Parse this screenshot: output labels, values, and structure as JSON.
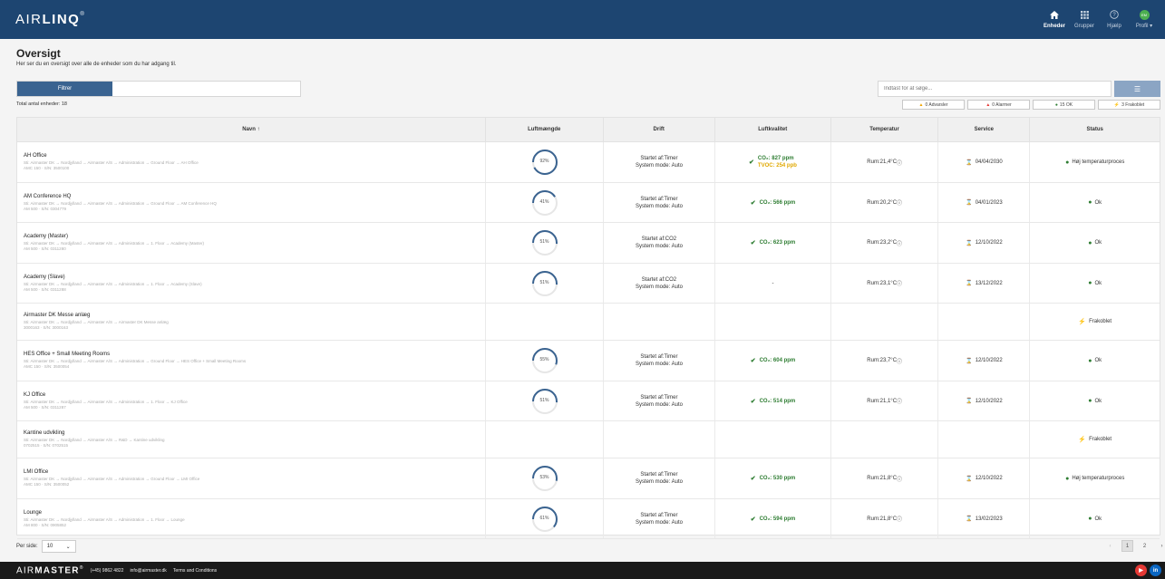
{
  "app": {
    "logo_light": "AIR",
    "logo_bold": "LINQ",
    "logo_mark": "®"
  },
  "nav": [
    {
      "label": "Enheder",
      "icon": "home-icon",
      "active": true
    },
    {
      "label": "Grupper",
      "icon": "grid-icon",
      "active": false
    },
    {
      "label": "Hjælp",
      "icon": "help-icon",
      "active": false
    },
    {
      "label": "Profil ▾",
      "icon": "profile-icon",
      "active": false,
      "badge": "EM"
    }
  ],
  "page": {
    "title": "Oversigt",
    "subtitle": "Her ser du en oversigt over alle de enheder som du har adgang til."
  },
  "filter": {
    "label": "Filtrer"
  },
  "total": "Total antal enheder: 18",
  "search": {
    "placeholder": "Indtast for at søge...",
    "button_icon": "list-icon"
  },
  "status_buttons": [
    {
      "label": "0 Advarsler",
      "icon": "warning-icon",
      "color": "#f0a500"
    },
    {
      "label": "0 Alarmer",
      "icon": "alarm-icon",
      "color": "#e53935"
    },
    {
      "label": "15 OK",
      "icon": "check-circle-icon",
      "color": "#2e7d32"
    },
    {
      "label": "3 Frakoblet",
      "icon": "bolt-icon",
      "color": "#333333"
    }
  ],
  "columns": {
    "name": "Navn ↑",
    "luft": "Luftmængde",
    "drift": "Drift",
    "kval": "Luftkvalitet",
    "temp": "Temperatur",
    "serv": "Service",
    "stat": "Status"
  },
  "rows": [
    {
      "name": "AH Office",
      "path": "Sti: Airmaster DK → Nordjylland → Airmaster A/S → Administration → Ground Floor → AH Office",
      "sn": "AMC 150 · S/N: 3500100",
      "luft": "92%",
      "luft_pct": 92,
      "drift1": "Startet af:Timer",
      "drift2": "System mode: Auto",
      "co2": "CO₂: 827 ppm",
      "tvoc": "TVOC: 254 ppb",
      "temp": "Rum:21,4°C",
      "serv": "04/04/2030",
      "stat": "Høj temperaturproces",
      "stat_type": "high"
    },
    {
      "name": "AM Conference HQ",
      "path": "Sti: Airmaster DK → Nordjylland → Airmaster A/S → Administration → Ground Floor → AM Conference HQ",
      "sn": "AM 500 · S/N: 0304779",
      "luft": "41%",
      "luft_pct": 41,
      "drift1": "Startet af:Timer",
      "drift2": "System mode: Auto",
      "co2": "CO₂: 566 ppm",
      "tvoc": "",
      "temp": "Rum:20,2°C",
      "serv": "04/01/2023",
      "stat": "Ok",
      "stat_type": "ok"
    },
    {
      "name": "Academy (Master)",
      "path": "Sti: Airmaster DK → Nordjylland → Airmaster A/S → Administration → 1. Floor → Academy (Master)",
      "sn": "AM 500 · S/N: 0311280",
      "luft": "51%",
      "luft_pct": 51,
      "drift1": "Startet af:CO2",
      "drift2": "System mode: Auto",
      "co2": "CO₂: 623 ppm",
      "tvoc": "",
      "temp": "Rum:23,2°C",
      "serv": "12/10/2022",
      "stat": "Ok",
      "stat_type": "ok"
    },
    {
      "name": "Academy (Slave)",
      "path": "Sti: Airmaster DK → Nordjylland → Airmaster A/S → Administration → 1. Floor → Academy (Slave)",
      "sn": "AM 500 · S/N: 0311288",
      "luft": "51%",
      "luft_pct": 51,
      "drift1": "Startet af:CO2",
      "drift2": "System mode: Auto",
      "co2": "",
      "dash": "-",
      "tvoc": "",
      "temp": "Rum:23,1°C",
      "serv": "13/12/2022",
      "stat": "Ok",
      "stat_type": "ok"
    },
    {
      "name": "Airmaster DK Messe anlæg",
      "path": "Sti: Airmaster DK → Nordjylland → Airmaster A/S → Airmaster DK Messe anlæg",
      "sn": "3000163 · S/N: 3000163",
      "luft": "",
      "drift1": "",
      "drift2": "",
      "co2": "",
      "tvoc": "",
      "temp": "",
      "serv": "",
      "stat": "Frakoblet",
      "stat_type": "off"
    },
    {
      "name": "HES Office + Small Meeting Rooms",
      "path": "Sti: Airmaster DK → Nordjylland → Airmaster A/S → Administration → Ground Floor → HES Office + Small Meeting Rooms",
      "sn": "AMC 150 · S/N: 3500054",
      "luft": "55%",
      "luft_pct": 55,
      "drift1": "Startet af:Timer",
      "drift2": "System mode: Auto",
      "co2": "CO₂: 604 ppm",
      "tvoc": "",
      "temp": "Rum:23,7°C",
      "serv": "12/10/2022",
      "stat": "Ok",
      "stat_type": "ok"
    },
    {
      "name": "KJ Office",
      "path": "Sti: Airmaster DK → Nordjylland → Airmaster A/S → Administration → 1. Floor → KJ Office",
      "sn": "AM 500 · S/N: 0311287",
      "luft": "51%",
      "luft_pct": 51,
      "drift1": "Startet af:Timer",
      "drift2": "System mode: Auto",
      "co2": "CO₂: 514 ppm",
      "tvoc": "",
      "temp": "Rum:21,1°C",
      "serv": "12/10/2022",
      "stat": "Ok",
      "stat_type": "ok"
    },
    {
      "name": "Kantine udvikling",
      "path": "Sti: Airmaster DK → Nordjylland → Airmaster A/S → R&D → Kantine udvikling",
      "sn": "0702515 · S/N: 0702515",
      "luft": "",
      "drift1": "",
      "drift2": "",
      "co2": "",
      "tvoc": "",
      "temp": "",
      "serv": "",
      "stat": "Frakoblet",
      "stat_type": "off"
    },
    {
      "name": "LMI Office",
      "path": "Sti: Airmaster DK → Nordjylland → Airmaster A/S → Administration → Ground Floor → LMI Office",
      "sn": "AMC 150 · S/N: 3500052",
      "luft": "53%",
      "luft_pct": 53,
      "drift1": "Startet af:Timer",
      "drift2": "System mode: Auto",
      "co2": "CO₂: 530 ppm",
      "tvoc": "",
      "temp": "Rum:21,8°C",
      "serv": "12/10/2022",
      "stat": "Høj temperaturproces",
      "stat_type": "high"
    },
    {
      "name": "Lounge",
      "path": "Sti: Airmaster DK → Nordjylland → Airmaster A/S → Administration → 1. Floor → Lounge",
      "sn": "AM 800 · S/N: 0905852",
      "luft": "61%",
      "luft_pct": 61,
      "drift1": "Startet af:Timer",
      "drift2": "System mode: Auto",
      "co2": "CO₂: 594 ppm",
      "tvoc": "",
      "temp": "Rum:21,8°C",
      "serv": "13/02/2023",
      "stat": "Ok",
      "stat_type": "ok"
    }
  ],
  "pagination": {
    "per_side_label": "Per side:",
    "per_side_value": "10",
    "prev": "‹",
    "pages": [
      "1",
      "2"
    ],
    "next": "›"
  },
  "footer": {
    "logo_light": "AIR",
    "logo_bold": "MASTER",
    "logo_mark": "®",
    "phone": "(+45) 9862 4822",
    "email": "info@airmaster.dk",
    "terms": "Terms and Conditions",
    "social": [
      {
        "icon": "youtube-icon",
        "color": "#e53935",
        "glyph": "▶"
      },
      {
        "icon": "linkedin-icon",
        "color": "#0a66c2",
        "glyph": "in"
      }
    ]
  },
  "colors": {
    "header": "#1d4571",
    "accent": "#3a6390",
    "ok": "#2e7d32",
    "warning": "#e0a800"
  }
}
